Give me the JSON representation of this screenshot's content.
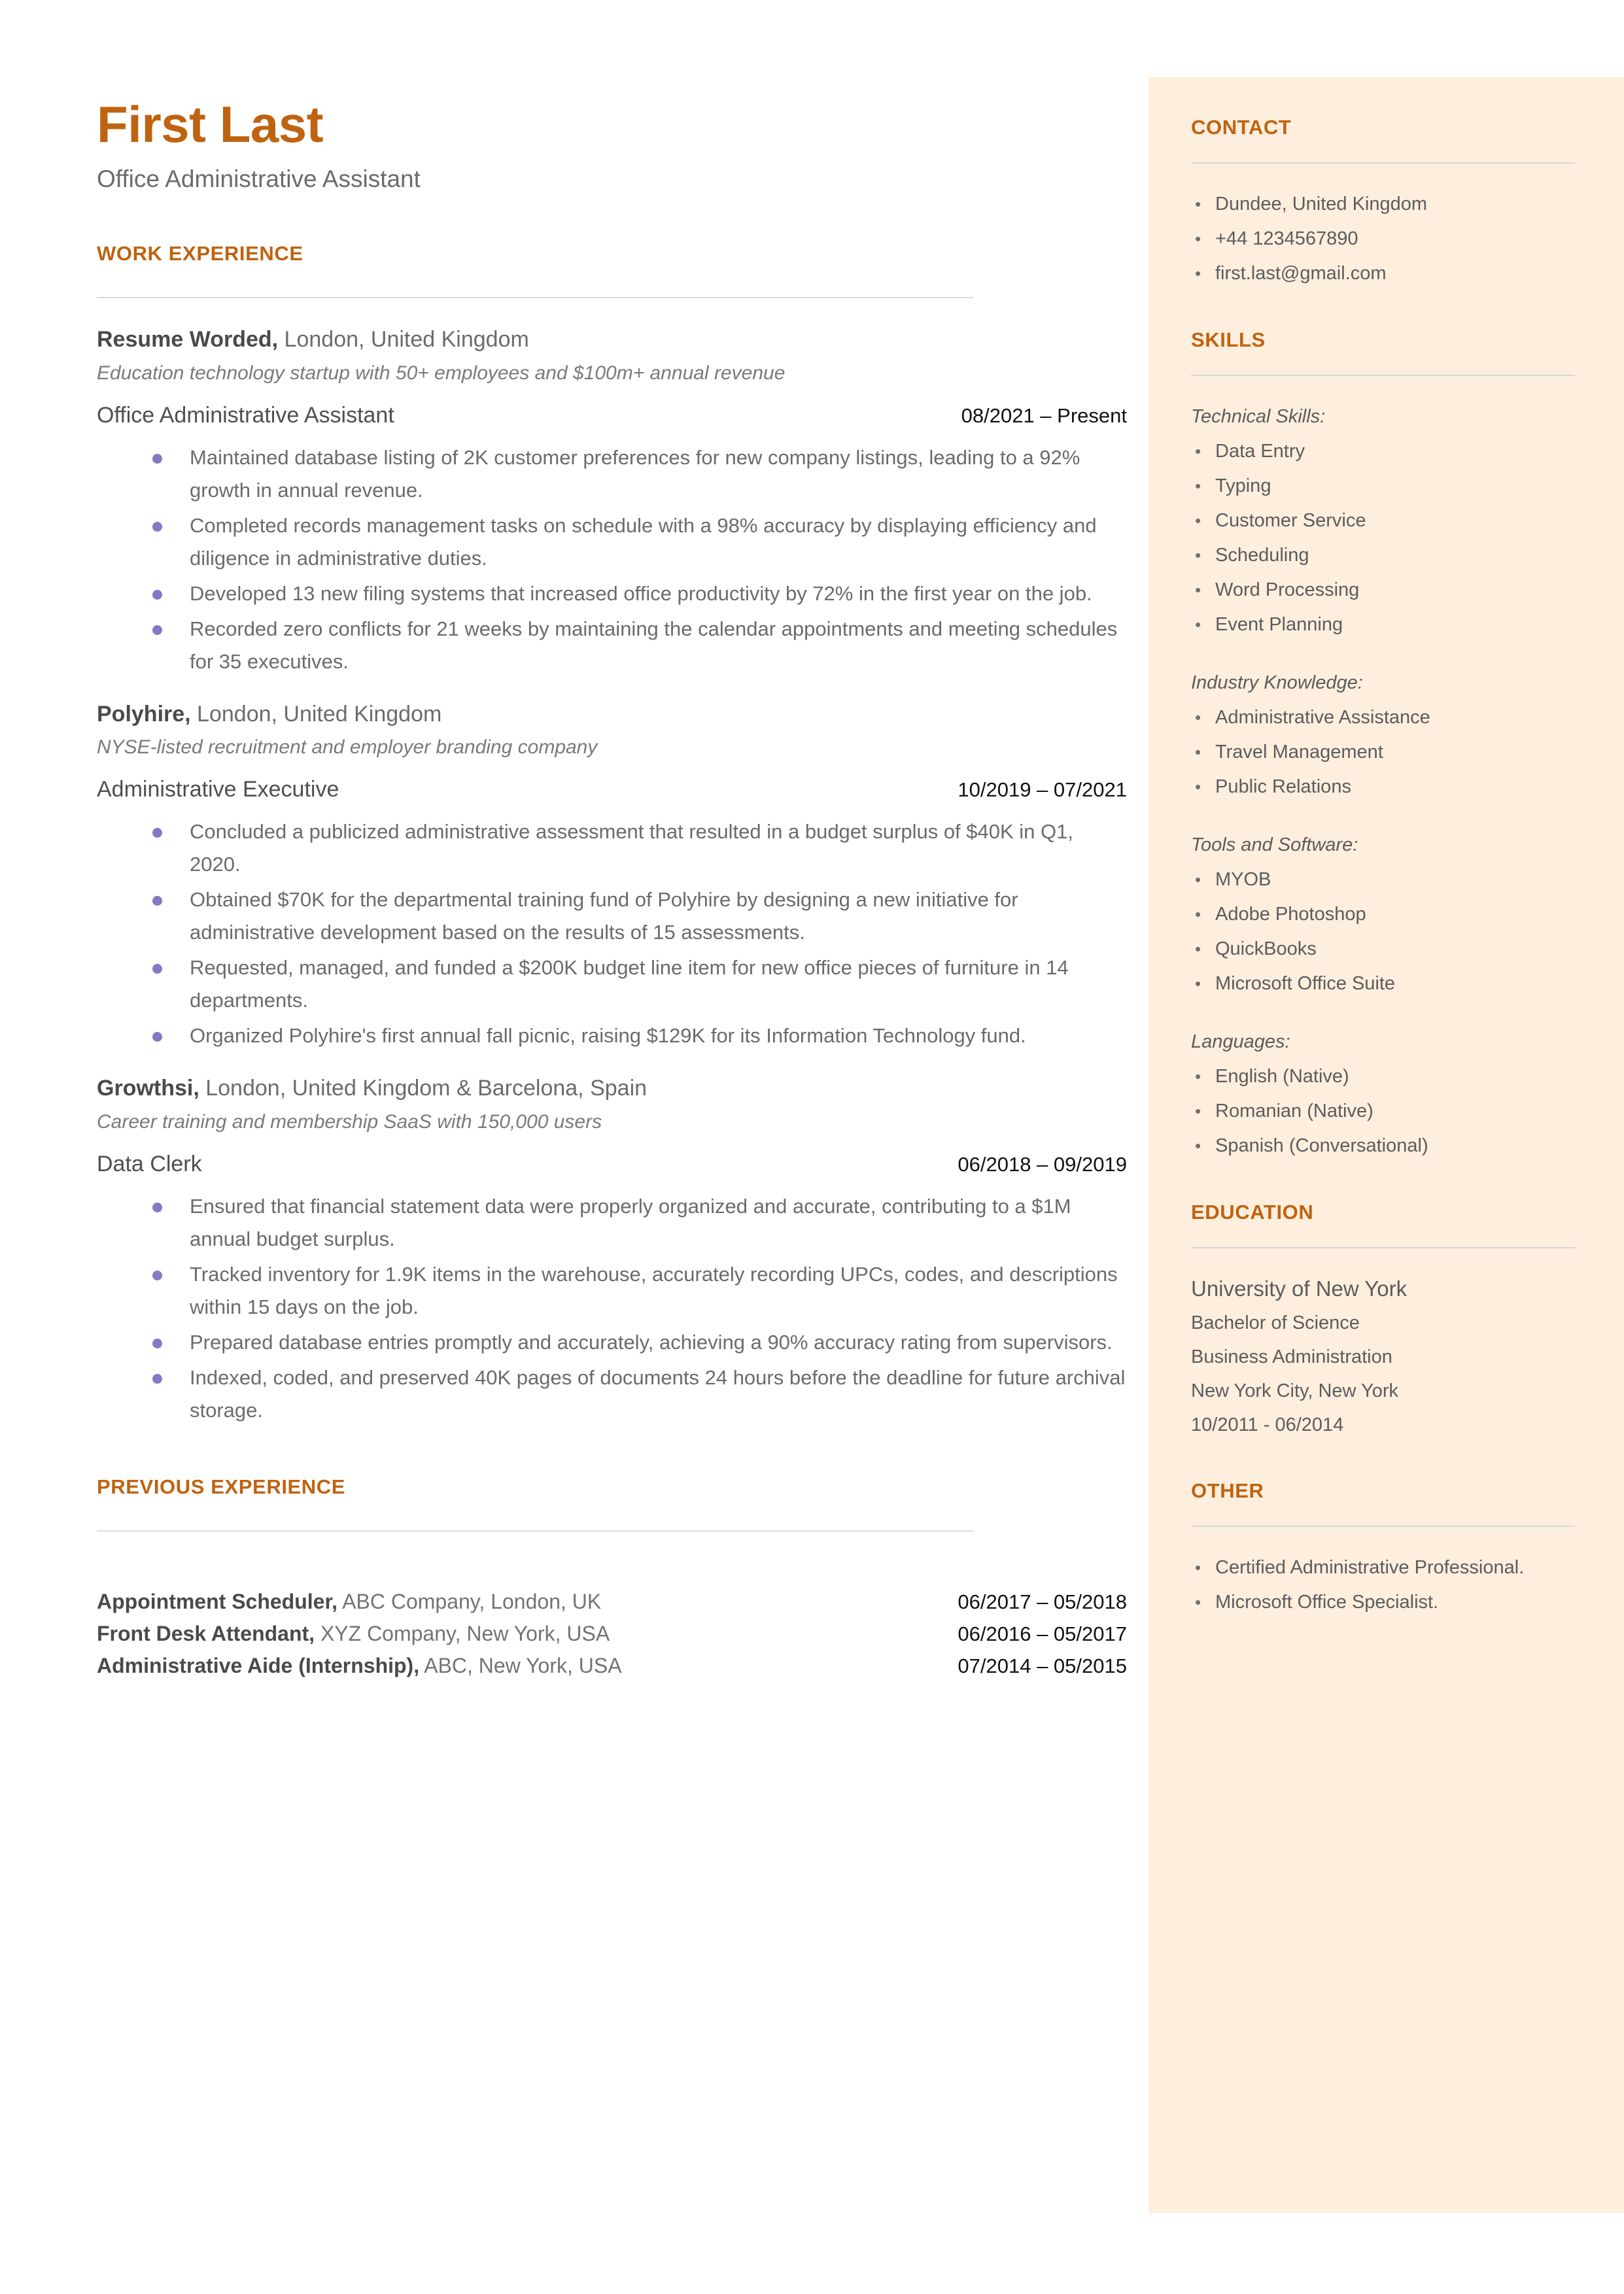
{
  "colors": {
    "accent_orange": "#bf6310",
    "sidebar_bg": "#fdeedd",
    "bullet_purple": "#8878c3",
    "body_gray": "#6b6b6b",
    "date_black": "#111111"
  },
  "header": {
    "name": "First Last",
    "subtitle": "Office Administrative Assistant"
  },
  "sections": {
    "work_experience_heading": "WORK EXPERIENCE",
    "previous_experience_heading": "PREVIOUS EXPERIENCE"
  },
  "jobs": [
    {
      "company_name": "Resume Worded,",
      "company_location": " London, United Kingdom",
      "blurb": "Education technology startup with 50+ employees and $100m+ annual revenue",
      "role": "Office Administrative Assistant",
      "dates": "08/2021 – Present",
      "bullets": [
        "Maintained database listing of 2K customer preferences for new company listings, leading to a 92% growth in annual revenue.",
        "Completed records management tasks on schedule with a 98% accuracy by displaying efficiency and diligence in administrative duties.",
        "Developed 13 new filing systems that increased office productivity by 72% in the first year on the job.",
        "Recorded zero conflicts for 21 weeks by maintaining the calendar appointments and meeting schedules for 35 executives."
      ]
    },
    {
      "company_name": "Polyhire,",
      "company_location": " London, United Kingdom",
      "blurb": "NYSE-listed recruitment and employer branding company",
      "role": "Administrative Executive",
      "dates": "10/2019 – 07/2021",
      "bullets": [
        "Concluded a publicized administrative assessment that resulted in a budget surplus of $40K in Q1, 2020.",
        "Obtained $70K for the departmental training fund of Polyhire by designing a new initiative for administrative development based on the results of 15 assessments.",
        "Requested, managed, and funded a $200K budget line item for new office pieces of furniture in 14 departments.",
        "Organized Polyhire's first annual fall picnic, raising $129K for its Information Technology fund."
      ]
    },
    {
      "company_name": "Growthsi,",
      "company_location": " London, United Kingdom & Barcelona, Spain",
      "blurb": "Career training and membership SaaS with 150,000 users",
      "role": "Data Clerk",
      "dates": "06/2018 – 09/2019",
      "bullets": [
        "Ensured that financial statement data were properly organized and accurate, contributing to a $1M annual budget surplus.",
        "Tracked inventory for 1.9K items in the warehouse, accurately recording UPCs, codes, and descriptions within 15 days on the job.",
        "Prepared database entries promptly and accurately, achieving a 90% accuracy rating from supervisors.",
        "Indexed, coded, and preserved 40K pages of documents 24 hours before the deadline for future archival storage."
      ]
    }
  ],
  "previous_experience": [
    {
      "title": "Appointment Scheduler,",
      "detail": " ABC Company, London, UK",
      "dates": "06/2017 – 05/2018"
    },
    {
      "title": "Front Desk Attendant,",
      "detail": " XYZ Company, New York, USA",
      "dates": "06/2016 – 05/2017"
    },
    {
      "title": "Administrative Aide (Internship),",
      "detail": " ABC, New York, USA",
      "dates": "07/2014 – 05/2015"
    }
  ],
  "sidebar": {
    "contact": {
      "heading": "CONTACT",
      "items": [
        "Dundee, United Kingdom",
        "+44 1234567890",
        "first.last@gmail.com"
      ]
    },
    "skills": {
      "heading": "SKILLS",
      "groups": [
        {
          "label": "Technical Skills:",
          "items": [
            "Data Entry",
            "Typing",
            "Customer Service",
            "Scheduling",
            "Word Processing",
            "Event Planning"
          ]
        },
        {
          "label": "Industry Knowledge:",
          "items": [
            "Administrative Assistance",
            "Travel Management",
            "Public Relations"
          ]
        },
        {
          "label": "Tools and Software:",
          "items": [
            "MYOB",
            "Adobe Photoshop",
            "QuickBooks",
            "Microsoft Office Suite"
          ]
        },
        {
          "label": "Languages:",
          "items": [
            "English (Native)",
            "Romanian (Native)",
            "Spanish (Conversational)"
          ]
        }
      ]
    },
    "education": {
      "heading": "EDUCATION",
      "school": "University of New York",
      "degree": "Bachelor of Science",
      "major": "Business Administration",
      "location": "New York City, New York",
      "dates": "10/2011 - 06/2014"
    },
    "other": {
      "heading": "OTHER",
      "items": [
        "Certified Administrative Professional.",
        "Microsoft Office Specialist."
      ]
    }
  }
}
